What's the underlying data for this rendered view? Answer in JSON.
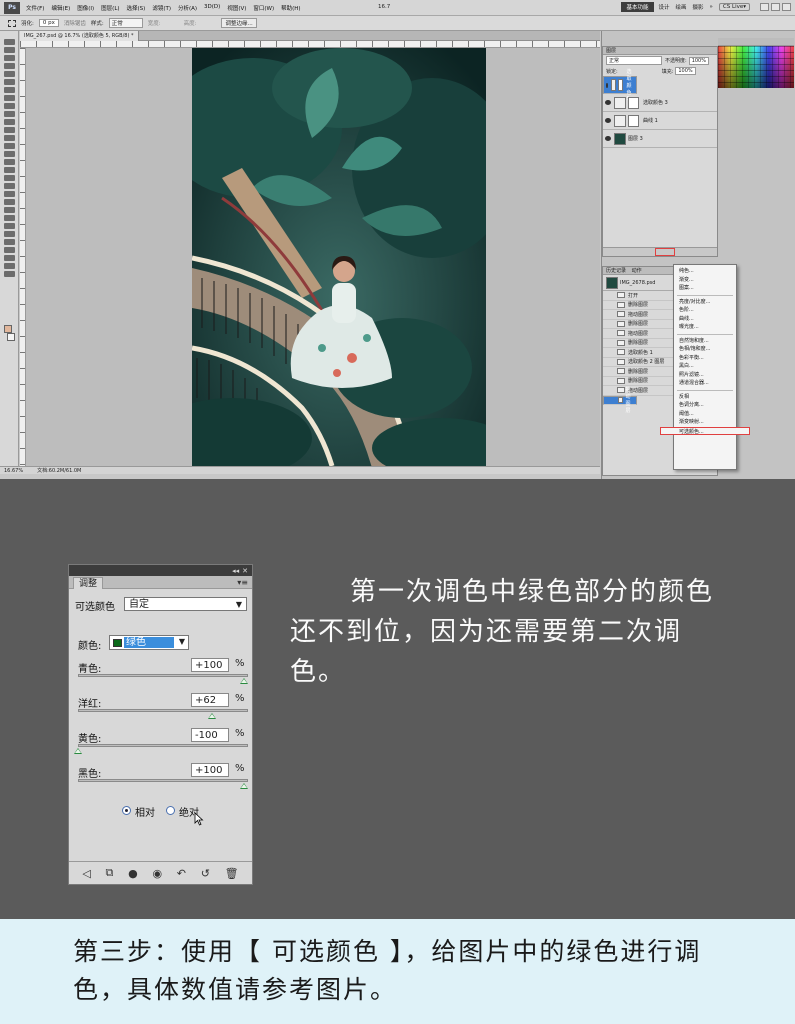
{
  "ps": {
    "logo": "Ps",
    "menu": [
      "文件(F)",
      "编辑(E)",
      "图像(I)",
      "图层(L)",
      "选择(S)",
      "滤镜(T)",
      "分析(A)",
      "3D(D)",
      "视图(V)",
      "窗口(W)",
      "帮助(H)"
    ],
    "zoom_combo": "16.7",
    "workspaces": {
      "active": "基本功能",
      "others": [
        "设计",
        "绘画",
        "摄影"
      ],
      "more": "»"
    },
    "cslive": "CS Live▾",
    "options": {
      "feather_label": "羽化:",
      "feather_value": "0 px",
      "antialias": "消除锯齿",
      "style_label": "样式:",
      "style_value": "正常",
      "width_label": "宽度:",
      "height_label": "高度:",
      "refine_edge": "调整边缘..."
    },
    "doc_tab": "IMG_267.psd @ 16.7% (选取颜色 5, RGB/8) *",
    "status": {
      "zoom": "16.67%",
      "doc": "文档:60.2M/61.0M"
    },
    "layers_panel": {
      "tab": "图层",
      "blend": "正常",
      "opacity_label": "不透明度:",
      "opacity": "100%",
      "lock_label": "锁定:",
      "fill_label": "填充:",
      "fill": "100%",
      "layers": [
        {
          "name": "选取颜色 5",
          "selected": true
        },
        {
          "name": "选取颜色 3",
          "selected": false
        },
        {
          "name": "曲线 1",
          "selected": false
        },
        {
          "name": "图层 3",
          "selected": false
        }
      ]
    },
    "history_panel": {
      "tabs": [
        "历史记录",
        "动作"
      ],
      "snapshot": "IMG_2678.psd",
      "items": [
        "打开",
        "删除图层",
        "拖动图层",
        "删除图层",
        "拖动图层",
        "删除图层",
        "选取颜色 1",
        "选取颜色 2 图层",
        "删除图层",
        "删除图层",
        "拖动图层",
        "拖动图层"
      ]
    },
    "adjust_menu": {
      "group1": [
        "纯色...",
        "渐变...",
        "图案..."
      ],
      "group2": [
        "亮度/对比度...",
        "色阶...",
        "曲线...",
        "曝光度..."
      ],
      "group3": [
        "自然饱和度...",
        "色相/饱和度...",
        "色彩平衡...",
        "黑白...",
        "照片滤镜...",
        "通道混合器..."
      ],
      "group4": [
        "反相",
        "色调分离...",
        "阈值...",
        "渐变映射...",
        "可选颜色..."
      ]
    }
  },
  "adjust_panel": {
    "collapse": "◂◂",
    "close": "✕",
    "tab": "调整",
    "menu_icon": "▾≡",
    "preset_label": "可选颜色",
    "preset_value": "自定",
    "color_label": "颜色:",
    "color_value": "绿色",
    "sliders": [
      {
        "label": "青色:",
        "value": "+100",
        "unit": "%",
        "level": 100
      },
      {
        "label": "洋红:",
        "value": "+62",
        "unit": "%",
        "level": 62
      },
      {
        "label": "黄色:",
        "value": "-100",
        "unit": "%",
        "level": -100
      },
      {
        "label": "黑色:",
        "value": "+100",
        "unit": "%",
        "level": 100
      }
    ],
    "mode_relative": "相对",
    "mode_absolute": "绝对"
  },
  "description": "第一次调色中绿色部分的颜色还不到位，因为还需要第二次调色。",
  "step": "第三步：使用【 可选颜色 】，给图片中的绿色进行调色，具体数值请参考图片。"
}
